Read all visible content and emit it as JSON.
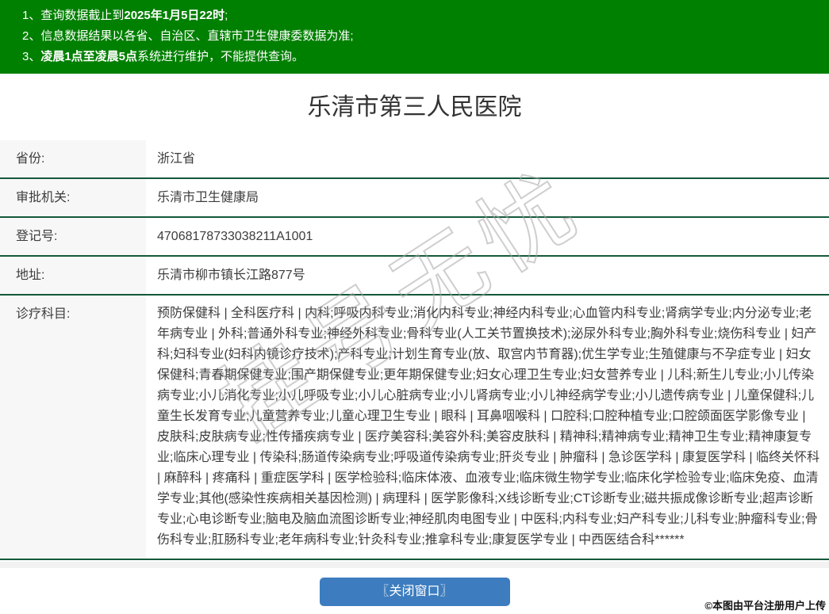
{
  "banner": {
    "bg_color": "#008000",
    "notices": [
      {
        "num": "1、",
        "pre": "查询数据截止到",
        "bold": "2025年1月5日22时",
        "post": ";"
      },
      {
        "num": "2、",
        "pre": "信息数据结果以各省、自治区、直辖市卫生健康委数据为准;",
        "bold": "",
        "post": ""
      },
      {
        "num": "3、",
        "pre": "",
        "bold": "凌晨1点至凌晨5点",
        "post": "系统进行维护，不能提供查询。"
      }
    ]
  },
  "title": "乐清市第三人民医院",
  "info_table": {
    "rows": [
      {
        "label": "省份:",
        "value": "浙江省"
      },
      {
        "label": "审批机关:",
        "value": "乐清市卫生健康局"
      },
      {
        "label": "登记号:",
        "value": "47068178733038211A1001"
      },
      {
        "label": "地址:",
        "value": "乐清市柳市镇长江路877号"
      },
      {
        "label": "诊疗科目:",
        "value": "预防保健科 | 全科医疗科 | 内科;呼吸内科专业;消化内科专业;神经内科专业;心血管内科专业;肾病学专业;内分泌专业;老年病专业 | 外科;普通外科专业;神经外科专业;骨科专业(人工关节置换技术);泌尿外科专业;胸外科专业;烧伤科专业 | 妇产科;妇科专业(妇科内镜诊疗技术);产科专业;计划生育专业(放、取宫内节育器);优生学专业;生殖健康与不孕症专业 | 妇女保健科;青春期保健专业;围产期保健专业;更年期保健专业;妇女心理卫生专业;妇女营养专业 | 儿科;新生儿专业;小儿传染病专业;小儿消化专业;小儿呼吸专业;小儿心脏病专业;小儿肾病专业;小儿神经病学专业;小儿遗传病专业 | 儿童保健科;儿童生长发育专业;儿童营养专业;儿童心理卫生专业 | 眼科 | 耳鼻咽喉科 | 口腔科;口腔种植专业;口腔颌面医学影像专业 | 皮肤科;皮肤病专业;性传播疾病专业 | 医疗美容科;美容外科;美容皮肤科 | 精神科;精神病专业;精神卫生专业;精神康复专业;临床心理专业 | 传染科;肠道传染病专业;呼吸道传染病专业;肝炎专业 | 肿瘤科 | 急诊医学科 | 康复医学科 | 临终关怀科 | 麻醉科 | 疼痛科 | 重症医学科 | 医学检验科;临床体液、血液专业;临床微生物学专业;临床化学检验专业;临床免疫、血清学专业;其他(感染性疾病相关基因检测) | 病理科 | 医学影像科;X线诊断专业;CT诊断专业;磁共振成像诊断专业;超声诊断专业;心电诊断专业;脑电及脑血流图诊断专业;神经肌肉电图专业 | 中医科;内科专业;妇产科专业;儿科专业;肿瘤科专业;骨伤科专业;肛肠科专业;老年病科专业;针灸科专业;推拿科专业;康复医学专业 | 中西医结合科******"
      }
    ]
  },
  "close_button": {
    "label": "〖关闭窗口〗",
    "bg_color": "#3d7dbf"
  },
  "watermark": "挂号无忧",
  "copyright": "©本图由平台注册用户上传",
  "colors": {
    "banner_bg": "#008000",
    "row_border": "#14593a",
    "label_bg": "#f7f7f7",
    "button_bg": "#3d7dbf"
  }
}
